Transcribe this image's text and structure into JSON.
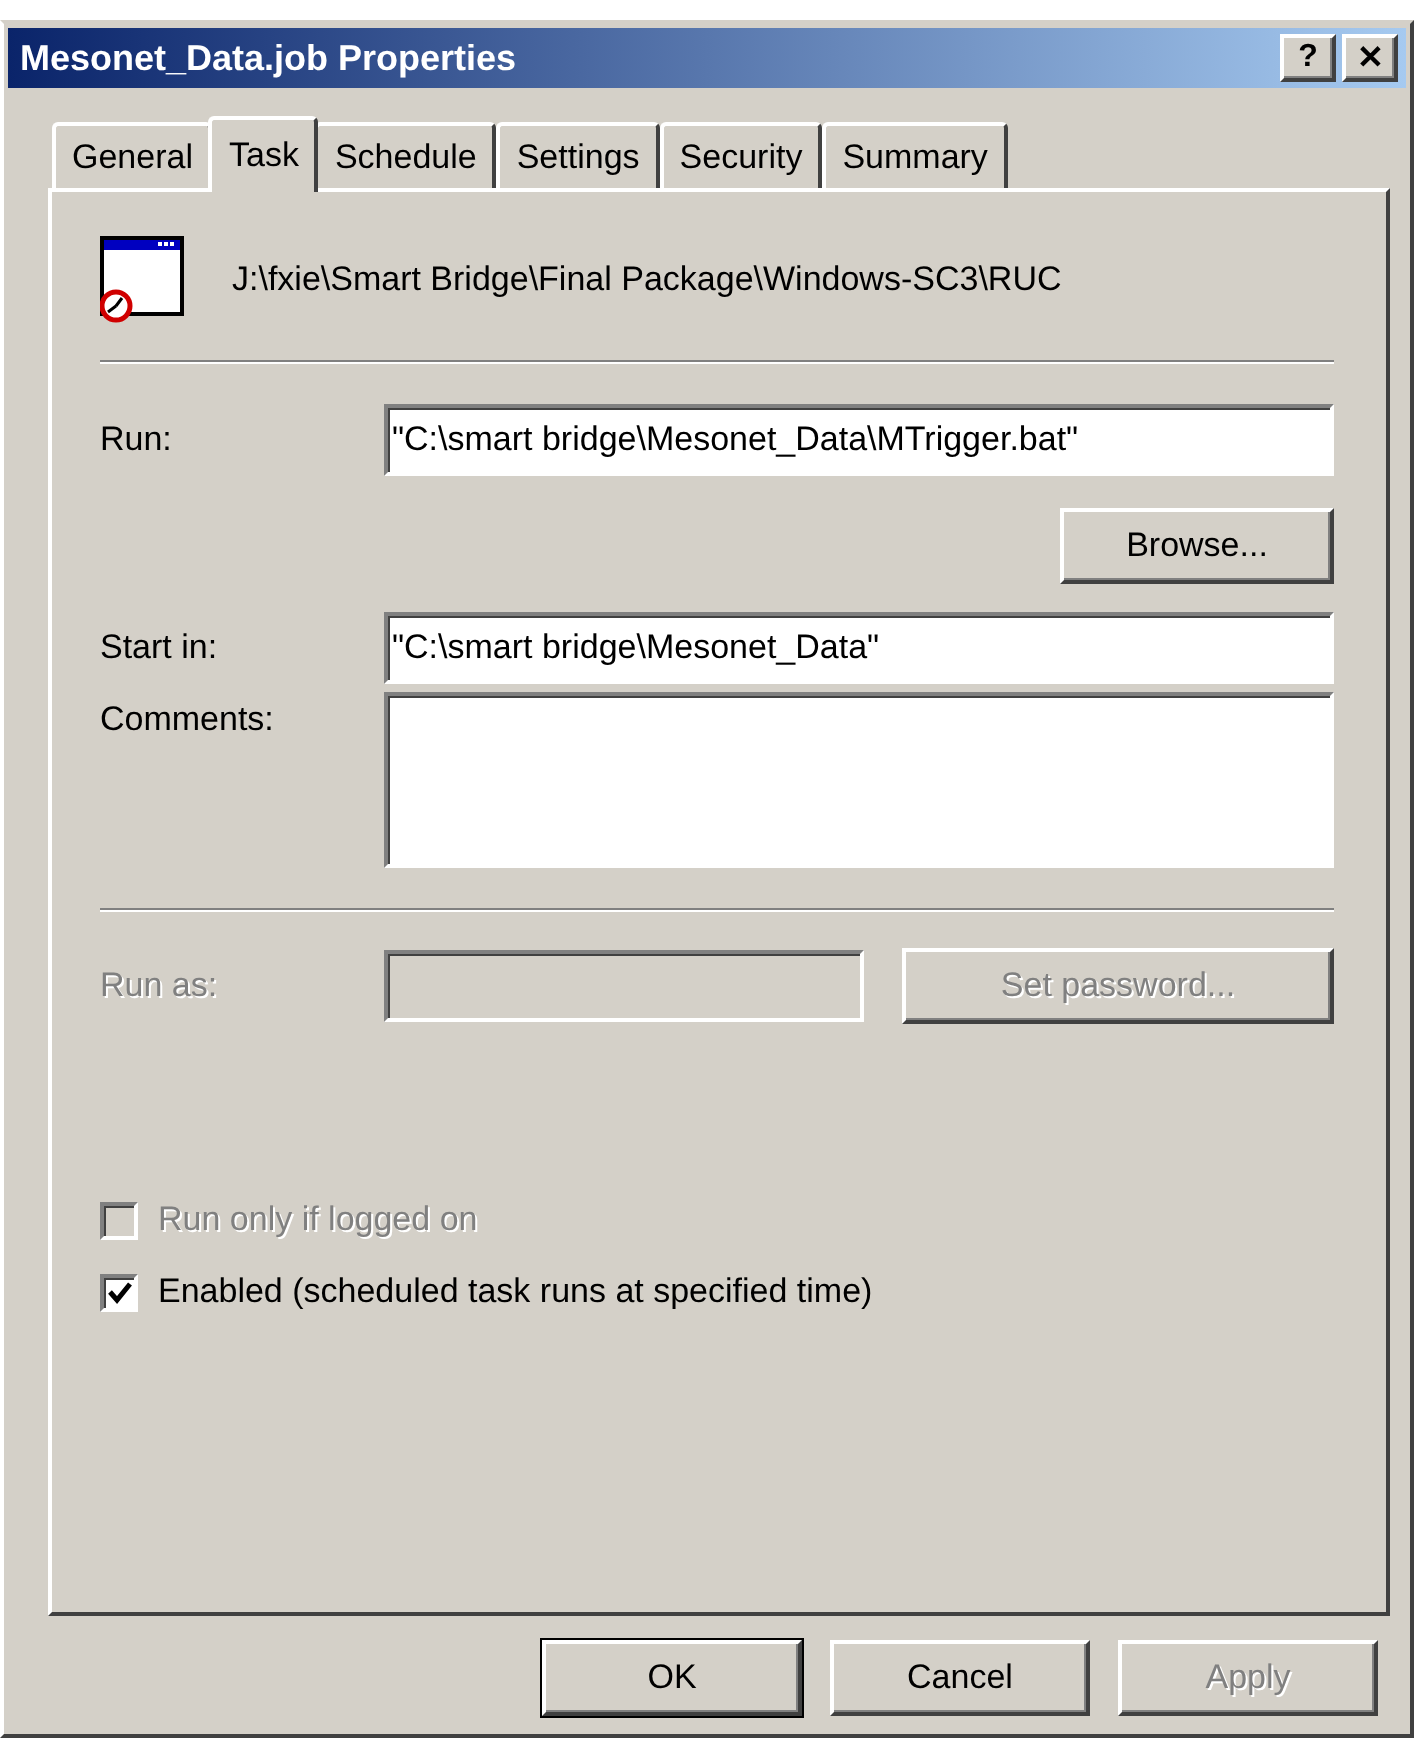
{
  "window": {
    "title": "Mesonet_Data.job Properties",
    "title_buttons": [
      {
        "kind": "help",
        "label": "?"
      },
      {
        "kind": "close",
        "label": "✕"
      }
    ]
  },
  "tabs": [
    {
      "label": "General",
      "selected": false
    },
    {
      "label": "Task",
      "selected": true
    },
    {
      "label": "Schedule",
      "selected": false
    },
    {
      "label": "Settings",
      "selected": false
    },
    {
      "label": "Security",
      "selected": false
    },
    {
      "label": "Summary",
      "selected": false
    }
  ],
  "task": {
    "path": "J:\\fxie\\Smart Bridge\\Final Package\\Windows-SC3\\RUC",
    "run": {
      "label": "Run:",
      "value": "\"C:\\smart bridge\\Mesonet_Data\\MTrigger.bat\"",
      "disabled": false
    },
    "browse": {
      "label": "Browse...",
      "disabled": false
    },
    "start_in": {
      "label": "Start in:",
      "value": "\"C:\\smart bridge\\Mesonet_Data\"",
      "disabled": false
    },
    "comments": {
      "label": "Comments:"
    },
    "run_as": {
      "label": "Run as:",
      "disabled": true
    },
    "set_password": {
      "label": "Set password...",
      "disabled": true
    },
    "checkboxes": [
      {
        "label": "Run only if logged on",
        "checked": false,
        "disabled": true
      },
      {
        "label": "Enabled (scheduled task runs at specified time)",
        "checked": true,
        "disabled": false
      }
    ]
  },
  "buttons": [
    {
      "label": "OK",
      "default": true,
      "disabled": false
    },
    {
      "label": "Cancel",
      "default": false,
      "disabled": false
    },
    {
      "label": "Apply",
      "default": false,
      "disabled": true
    }
  ]
}
